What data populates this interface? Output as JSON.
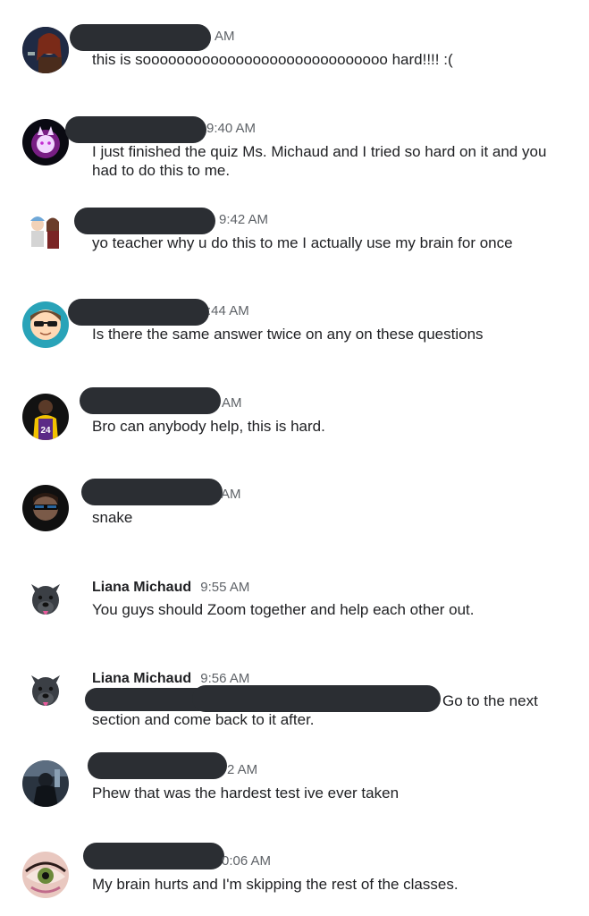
{
  "messages": [
    {
      "time": "AM",
      "text": "this is sooooooooooooooooooooooooooooo hard!!!! :("
    },
    {
      "time": "9:40 AM",
      "text": "I just finished the quiz Ms. Michaud and I tried so hard on it and you had to do this to me."
    },
    {
      "time": "9:42 AM",
      "text": "yo teacher why u do this to me I actually use my brain for once"
    },
    {
      "time": ":44 AM",
      "text": "Is there the same answer twice on any on these questions"
    },
    {
      "time": "AM",
      "text": "Bro can anybody help, this is hard."
    },
    {
      "time": "AM",
      "text": "snake"
    },
    {
      "name": "Liana Michaud",
      "time": "9:55 AM",
      "text": "You guys should Zoom together and help each other out."
    },
    {
      "name": "Liana Michaud",
      "time": "9:56 AM",
      "text_end": "Go to the next",
      "text_line2": "section and come back to it after."
    },
    {
      "time": "2 AM",
      "text": "Phew that was the hardest test ive ever taken"
    },
    {
      "time": "0:06 AM",
      "text": "My brain hurts and I'm skipping the rest of the classes."
    }
  ]
}
